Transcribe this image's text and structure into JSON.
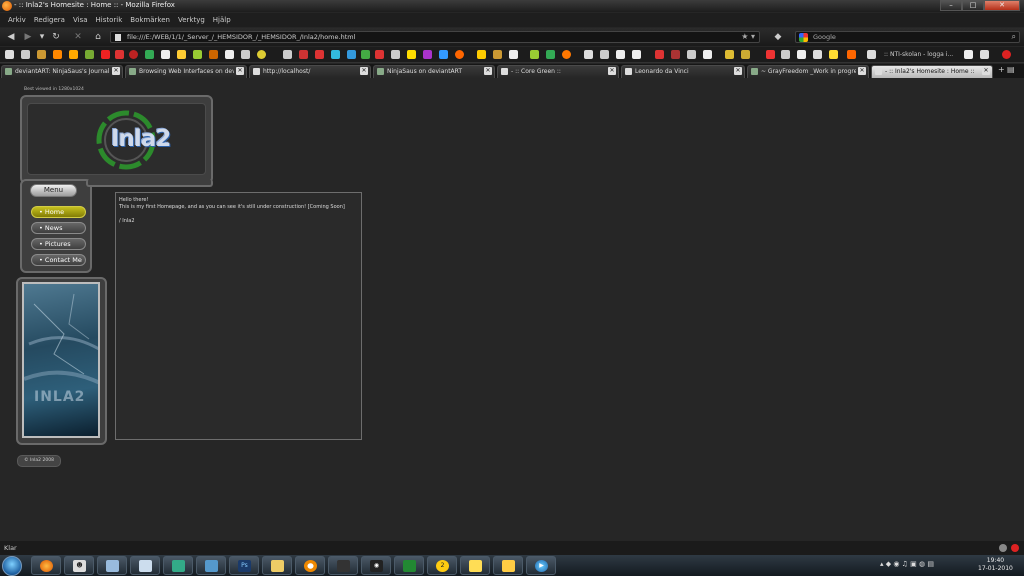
{
  "window": {
    "title": "- :: Inla2's Homesite : Home :: - Mozilla Firefox"
  },
  "menubar": [
    "Arkiv",
    "Redigera",
    "Visa",
    "Historik",
    "Bokmärken",
    "Verktyg",
    "Hjälp"
  ],
  "navbar": {
    "url": "file:///E:/WEB/1/1/_Server_/_HEMSIDOR_/_HEMSIDOR_/Inla2/home.html",
    "search_placeholder": "Google"
  },
  "bookmarks": {
    "last_label": ":: NTI-skolan - logga i..."
  },
  "tabs": [
    {
      "label": "deviantART: NinjaSaus's Journal",
      "active": false
    },
    {
      "label": "Browsing Web Interfaces on dev...",
      "active": false
    },
    {
      "label": "http://localhost/",
      "active": false
    },
    {
      "label": "NinjaSaus on deviantART",
      "active": false
    },
    {
      "label": "- :: Core Green ::",
      "active": false
    },
    {
      "label": "Leonardo da Vinci",
      "active": false
    },
    {
      "label": "~ GrayFreedom _Work in progre...",
      "active": false
    },
    {
      "label": "- :: Inla2's Homesite : Home ::",
      "active": true
    }
  ],
  "page": {
    "viewed_note": "Best viewed in 1280x1024",
    "logo_text": "Inla2",
    "menu_title": "Menu",
    "menu_items": [
      "• Home",
      "• News",
      "• Pictures",
      "• Contact Me"
    ],
    "art_text": "INLA2",
    "copyright": "© Inla2 2008",
    "main_lines": [
      "Hello there!",
      "This is my first Homepage, and as you can see it's still under construction! [Coming Soon]",
      "/ Inla2"
    ]
  },
  "status": {
    "text": "Klar"
  },
  "taskbar": {
    "time": "19:40",
    "date": "17-01-2010"
  }
}
